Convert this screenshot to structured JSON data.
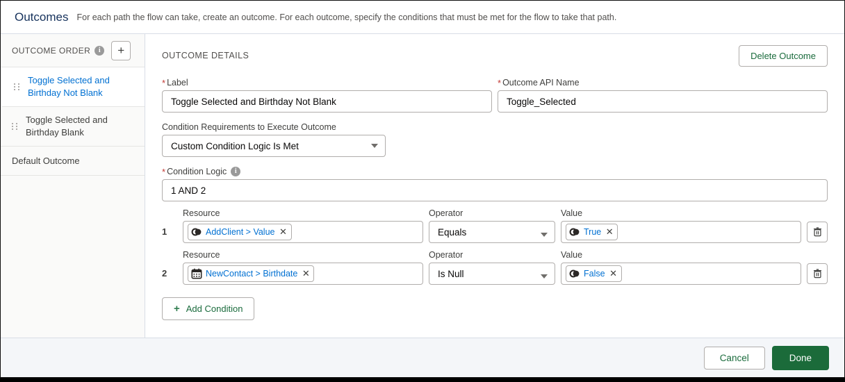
{
  "header": {
    "title": "Outcomes",
    "subtitle": "For each path the flow can take, create an outcome. For each outcome, specify the conditions that must be met for the flow to take that path."
  },
  "sidebar": {
    "heading": "OUTCOME ORDER",
    "add_button": "+",
    "items": [
      {
        "label": "Toggle Selected and Birthday Not Blank",
        "selected": true
      },
      {
        "label": "Toggle Selected and Birthday Blank",
        "selected": false
      }
    ],
    "default_outcome": "Default Outcome"
  },
  "details": {
    "section_title": "OUTCOME DETAILS",
    "delete_button": "Delete Outcome",
    "label_field": {
      "label": "Label",
      "required_marker": "*",
      "value": "Toggle Selected and Birthday Not Blank"
    },
    "api_name_field": {
      "label": "Outcome API Name",
      "required_marker": "*",
      "value": "Toggle_Selected"
    },
    "condition_requirements": {
      "label": "Condition Requirements to Execute Outcome",
      "value": "Custom Condition Logic Is Met"
    },
    "condition_logic": {
      "label": "Condition Logic",
      "required_marker": "*",
      "value": "1 AND 2"
    },
    "column_headers": {
      "resource": "Resource",
      "operator": "Operator",
      "value": "Value"
    },
    "conditions": [
      {
        "number": "1",
        "resource_pill": "AddClient > Value",
        "resource_icon": "toggle-icon",
        "operator": "Equals",
        "value_pill": "True",
        "value_icon": "toggle-icon",
        "remove_icon": "close-icon",
        "delete_icon": "trash-icon"
      },
      {
        "number": "2",
        "resource_pill": "NewContact > Birthdate",
        "resource_icon": "calendar-icon",
        "operator": "Is Null",
        "value_pill": "False",
        "value_icon": "toggle-icon",
        "remove_icon": "close-icon",
        "delete_icon": "trash-icon"
      }
    ],
    "add_condition_button": "Add Condition"
  },
  "footer": {
    "cancel": "Cancel",
    "done": "Done"
  },
  "colors": {
    "link": "#0070d2",
    "brand_green": "#1b6b3a",
    "required_red": "#c23934",
    "title_blue": "#16325c"
  }
}
